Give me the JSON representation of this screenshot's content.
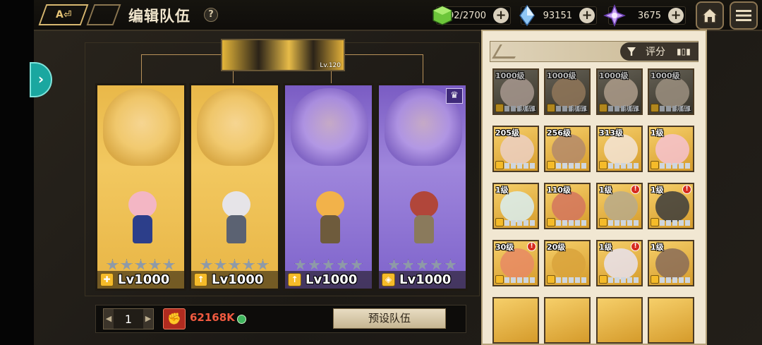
{
  "header": {
    "title": "编辑队伍",
    "help_label": "?",
    "resources": [
      {
        "name": "stamina",
        "icon": "green-cube-icon",
        "value": "692/2700",
        "plus": "+"
      },
      {
        "name": "blue-crystal",
        "icon": "blue-crystal-icon",
        "value": "93151",
        "plus": "+"
      },
      {
        "name": "purple-crystal",
        "icon": "purple-crystal-icon",
        "value": "3675",
        "plus": "+"
      }
    ]
  },
  "banner": {
    "level": "Lv.120"
  },
  "team_cards": [
    {
      "color": "gold",
      "level": "Lv1000",
      "stars": 5
    },
    {
      "color": "gold",
      "level": "Lv1000",
      "stars": 5
    },
    {
      "color": "purple",
      "level": "Lv1000",
      "stars": 5
    },
    {
      "color": "purple",
      "level": "Lv1000",
      "stars": 5,
      "crown": "♛"
    }
  ],
  "bottom": {
    "team_index": "1",
    "prev": "◀",
    "next": "▶",
    "power_value": "62168K",
    "preset_label": "预设队伍"
  },
  "sort": {
    "label": "评分",
    "icon": "bar-chart-icon"
  },
  "hero_grid": [
    [
      {
        "level": "1000级",
        "team": "队伍1",
        "style": "grey"
      },
      {
        "level": "1000级",
        "team": "队伍1",
        "style": "grey"
      },
      {
        "level": "1000级",
        "team": "队伍1",
        "style": "grey"
      },
      {
        "level": "1000级",
        "team": "队伍1",
        "style": "grey"
      }
    ],
    [
      {
        "level": "205级",
        "style": "gold"
      },
      {
        "level": "256级",
        "style": "gold"
      },
      {
        "level": "313级",
        "style": "gold"
      },
      {
        "level": "1级",
        "style": "gold"
      }
    ],
    [
      {
        "level": "1级",
        "style": "gold"
      },
      {
        "level": "110级",
        "style": "gold"
      },
      {
        "level": "1级",
        "style": "gold",
        "alert": "!"
      },
      {
        "level": "1级",
        "style": "gold",
        "alert": "!"
      }
    ],
    [
      {
        "level": "30级",
        "style": "gold",
        "alert": "!"
      },
      {
        "level": "20级",
        "style": "gold"
      },
      {
        "level": "1级",
        "style": "gold",
        "alert": "!"
      },
      {
        "level": "1级",
        "style": "gold"
      }
    ]
  ],
  "colors": {
    "accent_gold": "#f2c860",
    "accent_purple": "#9f86dc",
    "power_red": "#f05a40",
    "side_tab": "#1aa7a0"
  }
}
